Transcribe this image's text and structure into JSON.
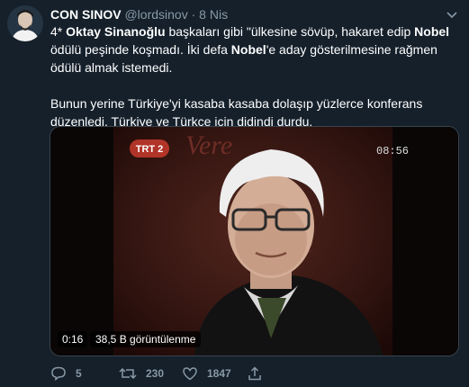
{
  "tweet": {
    "author_name": "CON SINOV",
    "handle": "@lordsinov",
    "separator": "·",
    "date": "8 Nis",
    "p1_prefix": "4* ",
    "p1_name": "Oktay Sinanoğlu",
    "p1_a": " başkaları gibi \"ülkesine sövüp, hakaret edip ",
    "p1_nobel1": "Nobel",
    "p1_b": " ödülü peşinde koşmadı. İki defa ",
    "p1_nobel2": "Nobel",
    "p1_c": "'e aday gösterilmesine rağmen ödülü almak istemedi.",
    "p2": "Bunun yerine Türkiye'yi kasaba kasaba dolaşıp yüzlerce konferans düzenledi. Türkiye ve Türkçe için didindi durdu."
  },
  "video": {
    "duration": "0:16",
    "views": "38,5 B görüntülenme",
    "channel_logo": "TRT 2",
    "clock": "08:56",
    "background_text": "Vere"
  },
  "actions": {
    "reply_count": "5",
    "retweet_count": "230",
    "like_count": "1847"
  },
  "colors": {
    "background": "#15202b",
    "muted": "#8899a6",
    "border": "#38444d"
  },
  "icons": [
    "chevron-down-icon",
    "reply-icon",
    "retweet-icon",
    "like-icon",
    "share-icon"
  ]
}
